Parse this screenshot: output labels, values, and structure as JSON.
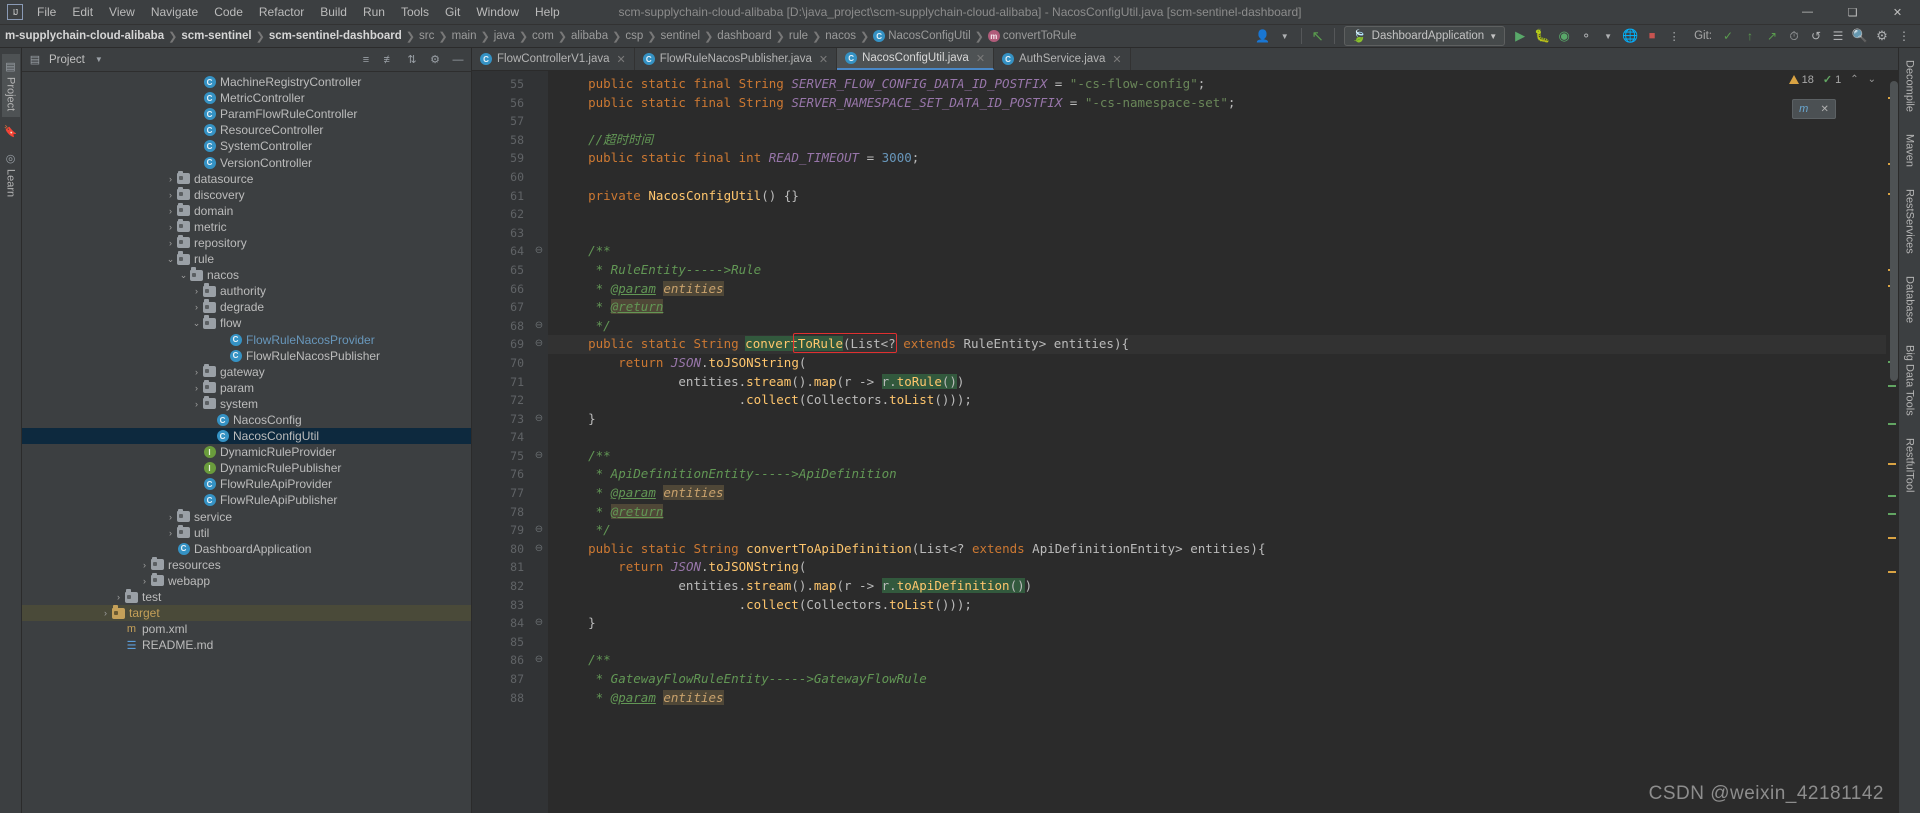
{
  "window": {
    "title": "scm-supplychain-cloud-alibaba [D:\\java_project\\scm-supplychain-cloud-alibaba] - NacosConfigUtil.java [scm-sentinel-dashboard]",
    "minimize": "—",
    "maximize": "❑",
    "close": "✕"
  },
  "menubar": {
    "items": [
      {
        "label": "File"
      },
      {
        "label": "Edit"
      },
      {
        "label": "View"
      },
      {
        "label": "Navigate"
      },
      {
        "label": "Code"
      },
      {
        "label": "Refactor"
      },
      {
        "label": "Build"
      },
      {
        "label": "Run"
      },
      {
        "label": "Tools"
      },
      {
        "label": "Git"
      },
      {
        "label": "Window"
      },
      {
        "label": "Help"
      }
    ]
  },
  "navbar": {
    "crumbs": [
      {
        "label": "m-supplychain-cloud-alibaba",
        "bold": false
      },
      {
        "label": "scm-sentinel",
        "bold": true
      },
      {
        "label": "scm-sentinel-dashboard",
        "bold": true
      },
      {
        "label": "src",
        "bold": false
      },
      {
        "label": "main",
        "bold": false
      },
      {
        "label": "java",
        "bold": false
      },
      {
        "label": "com",
        "bold": false
      },
      {
        "label": "alibaba",
        "bold": false
      },
      {
        "label": "csp",
        "bold": false
      },
      {
        "label": "sentinel",
        "bold": false
      },
      {
        "label": "dashboard",
        "bold": false
      },
      {
        "label": "rule",
        "bold": false
      },
      {
        "label": "nacos",
        "bold": false
      },
      {
        "label": "NacosConfigUtil",
        "bold": false,
        "icon": "class-icon"
      },
      {
        "label": "convertToRule",
        "bold": false,
        "icon": "method-icon"
      }
    ],
    "separator": "❯",
    "run_config": "DashboardApplication",
    "git_label": "Git:",
    "toolbar_icons": [
      "user-avatar-icon",
      "dropdown-icon",
      "undo-icon",
      "run-icon",
      "debug-icon",
      "run-with-coverage-icon",
      "profiler-icon",
      "stop-icon",
      "git-update-icon",
      "git-commit-icon",
      "git-push-icon",
      "history-icon",
      "revert-icon",
      "search-everywhere-icon",
      "settings-icon",
      "more-icon"
    ]
  },
  "left_tool_strip": {
    "items": [
      {
        "label": "Project",
        "icon": "project-icon",
        "active": true
      },
      {
        "label": "",
        "icon": "bookmarks-icon",
        "active": false
      },
      {
        "label": "Learn",
        "icon": "learn-icon",
        "active": false
      }
    ]
  },
  "right_tool_strip": {
    "items": [
      {
        "label": "Decompile",
        "icon": "decompile-icon"
      },
      {
        "label": "Maven",
        "icon": "maven-icon"
      },
      {
        "label": "RestServices",
        "icon": "rest-icon"
      },
      {
        "label": "Database",
        "icon": "database-icon"
      },
      {
        "label": "Big Data Tools",
        "icon": "bigdata-icon"
      },
      {
        "label": "RestfulTool",
        "icon": "restful-icon"
      }
    ]
  },
  "project_panel": {
    "title": "Project",
    "dropdown": "▾",
    "header_icons": [
      "collapse-all-icon",
      "expand-all-icon",
      "sort-icon",
      "settings-icon",
      "hide-icon"
    ],
    "tree": [
      {
        "indent": 13,
        "arrow": "",
        "icon": "class-icon",
        "label": "MachineRegistryController",
        "color": ""
      },
      {
        "indent": 13,
        "arrow": "",
        "icon": "class-icon",
        "label": "MetricController",
        "color": ""
      },
      {
        "indent": 13,
        "arrow": "",
        "icon": "class-icon",
        "label": "ParamFlowRuleController",
        "color": ""
      },
      {
        "indent": 13,
        "arrow": "",
        "icon": "class-icon",
        "label": "ResourceController",
        "color": ""
      },
      {
        "indent": 13,
        "arrow": "",
        "icon": "class-icon",
        "label": "SystemController",
        "color": ""
      },
      {
        "indent": 13,
        "arrow": "",
        "icon": "class-icon",
        "label": "VersionController",
        "color": ""
      },
      {
        "indent": 11,
        "arrow": "›",
        "icon": "folder-icon",
        "label": "datasource",
        "color": ""
      },
      {
        "indent": 11,
        "arrow": "›",
        "icon": "folder-icon",
        "label": "discovery",
        "color": ""
      },
      {
        "indent": 11,
        "arrow": "›",
        "icon": "folder-icon",
        "label": "domain",
        "color": ""
      },
      {
        "indent": 11,
        "arrow": "›",
        "icon": "folder-icon",
        "label": "metric",
        "color": ""
      },
      {
        "indent": 11,
        "arrow": "›",
        "icon": "folder-icon",
        "label": "repository",
        "color": ""
      },
      {
        "indent": 11,
        "arrow": "⌄",
        "icon": "folder-icon",
        "label": "rule",
        "color": ""
      },
      {
        "indent": 12,
        "arrow": "⌄",
        "icon": "folder-icon",
        "label": "nacos",
        "color": ""
      },
      {
        "indent": 13,
        "arrow": "›",
        "icon": "folder-icon",
        "label": "authority",
        "color": ""
      },
      {
        "indent": 13,
        "arrow": "›",
        "icon": "folder-icon",
        "label": "degrade",
        "color": ""
      },
      {
        "indent": 13,
        "arrow": "⌄",
        "icon": "folder-icon",
        "label": "flow",
        "color": ""
      },
      {
        "indent": 15,
        "arrow": "",
        "icon": "class-icon",
        "label": "FlowRuleNacosProvider",
        "color": "blue"
      },
      {
        "indent": 15,
        "arrow": "",
        "icon": "class-icon",
        "label": "FlowRuleNacosPublisher",
        "color": ""
      },
      {
        "indent": 13,
        "arrow": "›",
        "icon": "folder-icon",
        "label": "gateway",
        "color": ""
      },
      {
        "indent": 13,
        "arrow": "›",
        "icon": "folder-icon",
        "label": "param",
        "color": ""
      },
      {
        "indent": 13,
        "arrow": "›",
        "icon": "folder-icon",
        "label": "system",
        "color": ""
      },
      {
        "indent": 14,
        "arrow": "",
        "icon": "class-icon",
        "label": "NacosConfig",
        "color": ""
      },
      {
        "indent": 14,
        "arrow": "",
        "icon": "class-icon",
        "label": "NacosConfigUtil",
        "color": "",
        "selected": true
      },
      {
        "indent": 13,
        "arrow": "",
        "icon": "interface-icon",
        "label": "DynamicRuleProvider",
        "color": ""
      },
      {
        "indent": 13,
        "arrow": "",
        "icon": "interface-icon",
        "label": "DynamicRulePublisher",
        "color": ""
      },
      {
        "indent": 13,
        "arrow": "",
        "icon": "class-icon",
        "label": "FlowRuleApiProvider",
        "color": ""
      },
      {
        "indent": 13,
        "arrow": "",
        "icon": "class-icon",
        "label": "FlowRuleApiPublisher",
        "color": ""
      },
      {
        "indent": 11,
        "arrow": "›",
        "icon": "folder-icon",
        "label": "service",
        "color": ""
      },
      {
        "indent": 11,
        "arrow": "›",
        "icon": "folder-icon",
        "label": "util",
        "color": ""
      },
      {
        "indent": 11,
        "arrow": "",
        "icon": "class-icon",
        "label": "DashboardApplication",
        "color": ""
      },
      {
        "indent": 9,
        "arrow": "›",
        "icon": "folder-icon",
        "label": "resources",
        "color": ""
      },
      {
        "indent": 9,
        "arrow": "›",
        "icon": "folder-icon",
        "label": "webapp",
        "color": ""
      },
      {
        "indent": 7,
        "arrow": "›",
        "icon": "folder-icon",
        "label": "test",
        "color": ""
      },
      {
        "indent": 6,
        "arrow": "›",
        "icon": "folder-icon-orange",
        "label": "target",
        "color": "orange",
        "rowHighlight": true
      },
      {
        "indent": 7,
        "arrow": "",
        "icon": "maven-file-icon",
        "label": "pom.xml",
        "color": ""
      },
      {
        "indent": 7,
        "arrow": "",
        "icon": "markdown-file-icon",
        "label": "README.md",
        "color": ""
      }
    ]
  },
  "editor": {
    "tabs": [
      {
        "label": "FlowControllerV1.java",
        "icon": "class-icon",
        "active": false,
        "close": "✕"
      },
      {
        "label": "FlowRuleNacosPublisher.java",
        "icon": "class-icon",
        "active": false,
        "close": "✕"
      },
      {
        "label": "NacosConfigUtil.java",
        "icon": "class-icon",
        "active": true,
        "close": "✕"
      },
      {
        "label": "AuthService.java",
        "icon": "class-icon",
        "active": false,
        "close": "✕"
      }
    ],
    "inspection": {
      "warning_count": "18",
      "ok_count": "1",
      "up_arrow": "⌃",
      "down_arrow": "⌄"
    },
    "float_widget": {
      "left_label": "m",
      "close": "✕"
    },
    "first_line": 55,
    "lines": [
      {
        "n": 55,
        "at": "",
        "fold": "",
        "text": "    public static final String SERVER_FLOW_CONFIG_DATA_ID_POSTFIX = \"-cs-flow-config\";"
      },
      {
        "n": 56,
        "at": "",
        "fold": "",
        "text": "    public static final String SERVER_NAMESPACE_SET_DATA_ID_POSTFIX = \"-cs-namespace-set\";"
      },
      {
        "n": 57,
        "at": "",
        "fold": "",
        "text": ""
      },
      {
        "n": 58,
        "at": "",
        "fold": "",
        "text": "    //超时时间"
      },
      {
        "n": 59,
        "at": "",
        "fold": "",
        "text": "    public static final int READ_TIMEOUT = 3000;"
      },
      {
        "n": 60,
        "at": "",
        "fold": "",
        "text": ""
      },
      {
        "n": 61,
        "at": "",
        "fold": "",
        "text": "    private NacosConfigUtil() {}"
      },
      {
        "n": 62,
        "at": "",
        "fold": "",
        "text": ""
      },
      {
        "n": 63,
        "at": "",
        "fold": "",
        "text": ""
      },
      {
        "n": 64,
        "at": "",
        "fold": "⊖",
        "text": "    /**"
      },
      {
        "n": 65,
        "at": "",
        "fold": "",
        "text": "     * RuleEntity----->Rule"
      },
      {
        "n": 66,
        "at": "",
        "fold": "",
        "text": "     * @param entities"
      },
      {
        "n": 67,
        "at": "",
        "fold": "",
        "text": "     * @return"
      },
      {
        "n": 68,
        "at": "",
        "fold": "⊖",
        "text": "     */"
      },
      {
        "n": 69,
        "at": "@",
        "fold": "⊖",
        "text": "    public static String convertToRule(List<? extends RuleEntity> entities){"
      },
      {
        "n": 70,
        "at": "",
        "fold": "",
        "text": "        return JSON.toJSONString("
      },
      {
        "n": 71,
        "at": "",
        "fold": "",
        "text": "                entities.stream().map(r -> r.toRule())"
      },
      {
        "n": 72,
        "at": "",
        "fold": "",
        "text": "                        .collect(Collectors.toList()));"
      },
      {
        "n": 73,
        "at": "",
        "fold": "⊖",
        "text": "    }"
      },
      {
        "n": 74,
        "at": "",
        "fold": "",
        "text": ""
      },
      {
        "n": 75,
        "at": "",
        "fold": "⊖",
        "text": "    /**"
      },
      {
        "n": 76,
        "at": "",
        "fold": "",
        "text": "     * ApiDefinitionEntity----->ApiDefinition"
      },
      {
        "n": 77,
        "at": "",
        "fold": "",
        "text": "     * @param entities"
      },
      {
        "n": 78,
        "at": "",
        "fold": "",
        "text": "     * @return"
      },
      {
        "n": 79,
        "at": "",
        "fold": "⊖",
        "text": "     */"
      },
      {
        "n": 80,
        "at": "@",
        "fold": "⊖",
        "text": "    public static String convertToApiDefinition(List<? extends ApiDefinitionEntity> entities){"
      },
      {
        "n": 81,
        "at": "",
        "fold": "",
        "text": "        return JSON.toJSONString("
      },
      {
        "n": 82,
        "at": "",
        "fold": "",
        "text": "                entities.stream().map(r -> r.toApiDefinition())"
      },
      {
        "n": 83,
        "at": "",
        "fold": "",
        "text": "                        .collect(Collectors.toList()));"
      },
      {
        "n": 84,
        "at": "",
        "fold": "⊖",
        "text": "    }"
      },
      {
        "n": 85,
        "at": "",
        "fold": "",
        "text": ""
      },
      {
        "n": 86,
        "at": "",
        "fold": "⊖",
        "text": "    /**"
      },
      {
        "n": 87,
        "at": "",
        "fold": "",
        "text": "     * GatewayFlowRuleEntity----->GatewayFlowRule"
      },
      {
        "n": 88,
        "at": "",
        "fold": "",
        "text": "     * @param entities"
      }
    ],
    "highlight_box_text": "r.toRule()"
  },
  "watermark": "CSDN @weixin_42181142",
  "colors": {
    "accent": "#4a88c7",
    "selection": "#0d293e",
    "warning": "#d9a343",
    "ok": "#62a562",
    "redbox": "#e03030",
    "editor_bg": "#2b2b2b",
    "panel_bg": "#3c3f41"
  }
}
